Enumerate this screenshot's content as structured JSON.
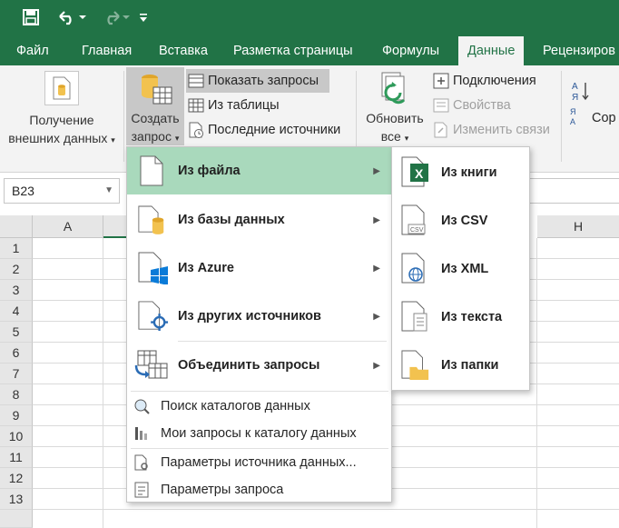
{
  "titlebar": {
    "save_icon": "save-icon",
    "undo_icon": "undo-icon",
    "redo_icon": "redo-icon",
    "customize_icon": "customize-qat-icon"
  },
  "tabs": [
    {
      "label": "Файл"
    },
    {
      "label": "Главная"
    },
    {
      "label": "Вставка"
    },
    {
      "label": "Разметка страницы"
    },
    {
      "label": "Формулы"
    },
    {
      "label": "Данные",
      "active": true
    },
    {
      "label": "Рецензиров"
    }
  ],
  "ribbon": {
    "get_external": {
      "line1": "Получение",
      "line2": "внешних данных"
    },
    "new_query": {
      "line1": "Создать",
      "line2": "запрос"
    },
    "show_queries": "Показать запросы",
    "from_table": "Из таблицы",
    "recent_sources": "Последние источники",
    "refresh_all": {
      "line1": "Обновить",
      "line2": "все"
    },
    "connections": "Подключения",
    "properties": "Свойства",
    "edit_links": "Изменить связи",
    "sort": "Сор"
  },
  "namebox": {
    "value": "B23"
  },
  "grid": {
    "columns": [
      "A",
      "H"
    ],
    "rows": [
      "1",
      "2",
      "3",
      "4",
      "5",
      "6",
      "7",
      "8",
      "9",
      "10",
      "11",
      "12",
      "13"
    ]
  },
  "menu_main": {
    "items": [
      {
        "label": "Из файла"
      },
      {
        "label": "Из базы данных"
      },
      {
        "label": "Из Azure"
      },
      {
        "label": "Из других источников"
      },
      {
        "label": "Объединить запросы"
      }
    ],
    "lower_items": [
      {
        "label": "Поиск каталогов данных"
      },
      {
        "label": "Мои запросы к каталогу данных"
      },
      {
        "label": "Параметры источника данных..."
      },
      {
        "label": "Параметры запроса"
      }
    ]
  },
  "menu_file": {
    "items": [
      {
        "label": "Из книги"
      },
      {
        "label": "Из CSV"
      },
      {
        "label": "Из XML"
      },
      {
        "label": "Из текста"
      },
      {
        "label": "Из папки"
      }
    ]
  },
  "colors": {
    "brand": "#217346",
    "highlight": "#a9d9bc"
  }
}
